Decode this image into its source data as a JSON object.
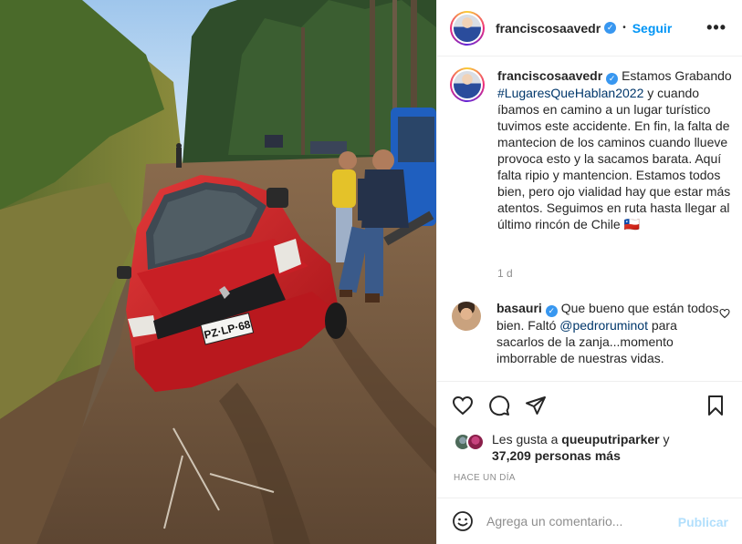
{
  "post": {
    "username": "franciscosaavedr",
    "verified_icon": "verified-badge-icon",
    "follow_label": "Seguir",
    "more_icon": "more-options-icon",
    "image": {
      "alt": "",
      "license_plate": "PZ·LP·68"
    },
    "caption": {
      "username": "franciscosaavedr",
      "text_before_hashtag": "Estamos Grabando",
      "hashtag": "#LugaresQueHablan2022",
      "text_after_hashtag": "y cuando íbamos en camino a un lugar turístico tuvimos este accidente. En fin, la falta de mantecion de los caminos cuando llueve provoca esto y la sacamos barata. Aquí falta ripio y mantencion. Estamos todos bien, pero ojo vialidad hay que estar más atentos. Seguimos en ruta hasta llegar al último rincón de Chile 🇨🇱",
      "time": "1 d"
    },
    "comment": {
      "username": "basauri",
      "text_before_mention": "Que bueno que están todos bien. Faltó",
      "mention": "@pedroruminot",
      "text_after_mention": "para sacarlos de la zanja...momento imborrable de nuestras vidas."
    },
    "likes": {
      "prefix": "Les gusta a",
      "user": "queuputriparker",
      "connector": "y",
      "others": "37,209 personas más"
    },
    "date": "HACE UN DÍA",
    "add_comment": {
      "placeholder": "Agrega un comentario...",
      "publish_label": "Publicar"
    },
    "colors": {
      "link_blue": "#0095f6",
      "hashtag_blue": "#00376b",
      "muted_gray": "#8e8e8e",
      "publish_disabled": "#b2dffc",
      "car_red": "#d01f26"
    }
  }
}
